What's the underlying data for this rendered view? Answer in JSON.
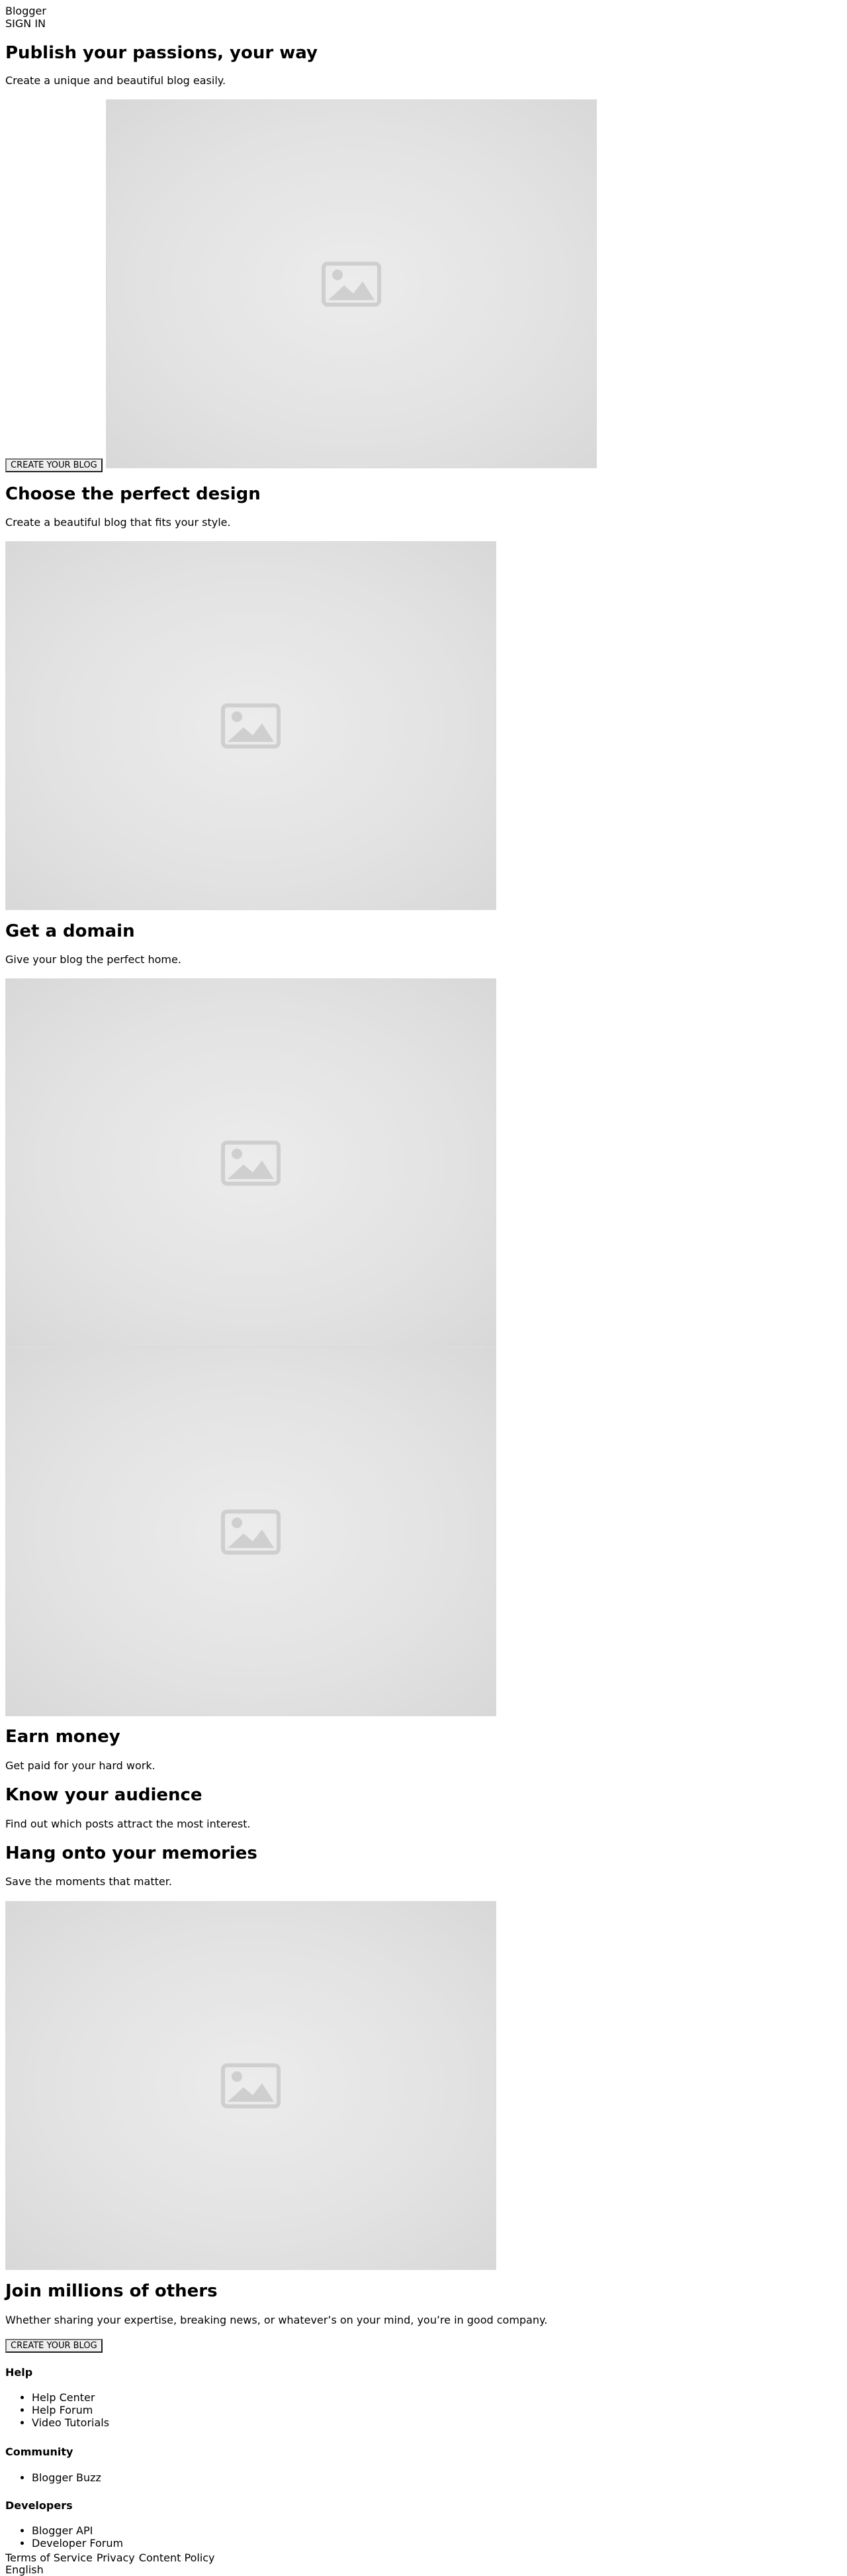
{
  "header": {
    "brand": "Blogger",
    "sign_in": "SIGN IN"
  },
  "hero": {
    "title": "Publish your passions, your way",
    "subtitle": "Create a unique and beautiful blog easily.",
    "cta": "CREATE YOUR BLOG"
  },
  "sections": {
    "design": {
      "title": "Choose the perfect design",
      "text": "Create a beautiful blog that fits your style."
    },
    "domain": {
      "title": "Get a domain",
      "text": "Give your blog the perfect home."
    },
    "money": {
      "title": "Earn money",
      "text": "Get paid for your hard work."
    },
    "audience": {
      "title": "Know your audience",
      "text": "Find out which posts attract the most interest."
    },
    "memories": {
      "title": "Hang onto your memories",
      "text": "Save the moments that matter."
    },
    "join": {
      "title": "Join millions of others",
      "text": "Whether sharing your expertise, breaking news, or whatever’s on your mind, you’re in good company.",
      "cta": "CREATE YOUR BLOG"
    }
  },
  "footer": {
    "help": {
      "title": "Help",
      "links": [
        "Help Center",
        "Help Forum",
        "Video Tutorials"
      ]
    },
    "community": {
      "title": "Community",
      "links": [
        "Blogger Buzz"
      ]
    },
    "developers": {
      "title": "Developers",
      "links": [
        "Blogger API",
        "Developer Forum"
      ]
    },
    "legal": [
      "Terms of Service",
      "Privacy",
      "Content Policy"
    ],
    "language": "English"
  },
  "icons": {
    "image_placeholder": "image-placeholder-icon"
  },
  "colors": {
    "placeholder_bg": "#e4e4e4",
    "placeholder_icon": "#cfcfcf"
  }
}
